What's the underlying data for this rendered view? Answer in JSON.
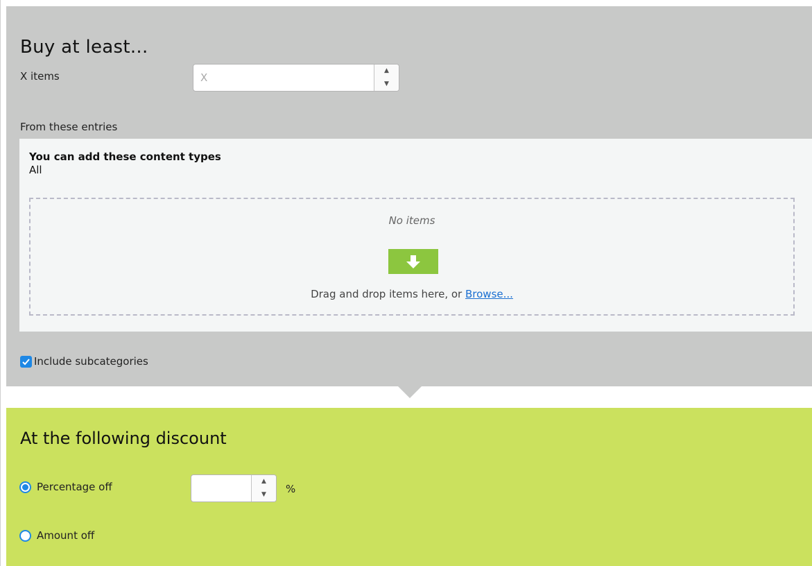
{
  "buy_section": {
    "title": "Buy at least...",
    "x_items_label": "X items",
    "x_items_placeholder": "X",
    "from_entries_label": "From these entries",
    "content_types_title": "You can add these content types",
    "content_types_value": "All",
    "dropzone": {
      "empty_text": "No items",
      "drag_text": "Drag and drop items here, or ",
      "browse_link": "Browse..."
    },
    "include_subcategories": {
      "label": "Include subcategories",
      "checked": true
    }
  },
  "discount_section": {
    "title": "At the following discount",
    "options": [
      {
        "label": "Percentage off",
        "selected": true,
        "value": "",
        "unit": "%"
      },
      {
        "label": "Amount off",
        "selected": false
      }
    ]
  },
  "colors": {
    "buy_background": "#c8c9c8",
    "panel_background": "#f4f6f6",
    "discount_background": "#cbe15e",
    "drop_icon": "#8cc63f",
    "accent_blue": "#1e88e5",
    "link": "#1a6fd1"
  },
  "icons": {
    "drop": "download-arrow-icon",
    "spin_up": "caret-up-icon",
    "spin_down": "caret-down-icon",
    "checkbox": "checkmark-icon"
  }
}
